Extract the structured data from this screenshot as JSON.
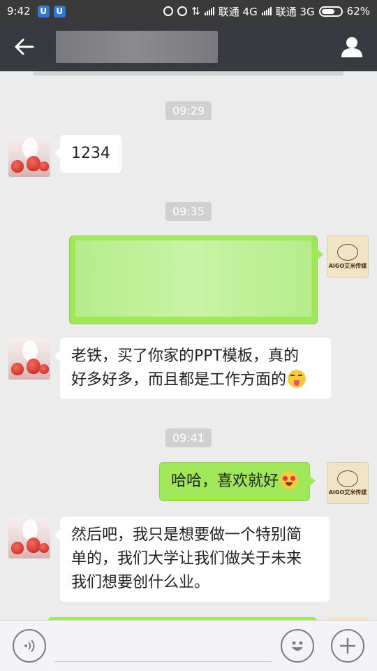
{
  "status_bar": {
    "time": "9:42",
    "app_badges": [
      "U",
      "U"
    ],
    "carrier1": "联通 4G",
    "carrier2": "联通 3G",
    "battery": "62%"
  },
  "header": {
    "title": ""
  },
  "messages": [
    {
      "type": "timestamp",
      "text": "09:29"
    },
    {
      "type": "text",
      "side": "left",
      "text": "1234"
    },
    {
      "type": "timestamp",
      "text": "09:35"
    },
    {
      "type": "blurred",
      "side": "right",
      "text": ""
    },
    {
      "type": "text",
      "side": "left",
      "line1": "老铁，买了你家的PPT模板，真的",
      "line2": "好多好多，而且都是工作方面的",
      "emoji": "squinting-tongue-emoji"
    },
    {
      "type": "timestamp",
      "text": "09:41"
    },
    {
      "type": "text",
      "side": "right",
      "text": "哈哈，喜欢就好",
      "emoji": "heart-eyes-emoji"
    },
    {
      "type": "text",
      "side": "left",
      "line1": "然后吧，我只是想要做一个特别简",
      "line2": "单的，我们大学让我们做关于未来",
      "line3": "我们想要创什么业。"
    }
  ],
  "avatars": {
    "friend": "strawberry-rabbit-avatar",
    "me": {
      "icon": "aigo-logo-avatar",
      "text": "AIGO艾米传媒"
    }
  },
  "input_bar": {
    "value": ""
  },
  "colors": {
    "sent_bubble": "#a0e759",
    "nav": "#393a3f",
    "background": "#ececec"
  }
}
